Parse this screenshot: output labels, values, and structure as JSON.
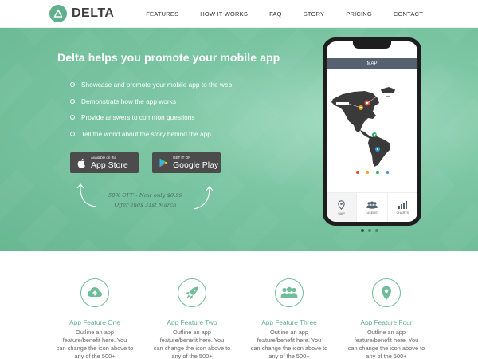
{
  "brand": {
    "name": "DELTA"
  },
  "nav": {
    "items": [
      {
        "label": "FEATURES"
      },
      {
        "label": "HOW IT WORKS"
      },
      {
        "label": "FAQ"
      },
      {
        "label": "STORY"
      },
      {
        "label": "PRICING"
      },
      {
        "label": "CONTACT"
      }
    ]
  },
  "hero": {
    "title": "Delta helps you promote your mobile app",
    "bullets": [
      "Showcase and promote your mobile app to the web",
      "Demonstrate how the app works",
      "Provide answers to common questions",
      "Tell the world about the story behind the app"
    ],
    "appstore": {
      "small": "Available on the",
      "big": "App Store"
    },
    "googleplay": {
      "small": "GET IT ON",
      "big": "Google Play"
    },
    "offer": {
      "line1": "50% OFF - Now only $0.99",
      "line2": "Offer ends 31st March"
    }
  },
  "phone": {
    "header": "MAP",
    "tabs": [
      {
        "label": "MAP",
        "icon": "map-pin-icon"
      },
      {
        "label": "USERS",
        "icon": "users-icon"
      },
      {
        "label": "CHARTS",
        "icon": "bar-chart-icon"
      }
    ],
    "dot_colors": [
      "#e74c3c",
      "#f39c12",
      "#27ae60",
      "#3498db"
    ],
    "marker_colors": [
      "#e74c3c",
      "#f39c12",
      "#27ae60",
      "#3498db"
    ]
  },
  "features": [
    {
      "title": "App Feature One",
      "desc": [
        "Outline an app",
        "feature/benefit here. You",
        "can change the icon above to",
        "any of the 500+"
      ],
      "icon": "cloud-upload-icon"
    },
    {
      "title": "App Feature Two",
      "desc": [
        "Outline an app",
        "feature/benefit here. You",
        "can change the icon above to",
        "any of the 500+"
      ],
      "icon": "rocket-icon"
    },
    {
      "title": "App Feature Three",
      "desc": [
        "Outline an app",
        "feature/benefit here. You",
        "can change the icon above to",
        "any of the 500+"
      ],
      "icon": "users-icon"
    },
    {
      "title": "App Feature Four",
      "desc": [
        "Outline an app",
        "feature/benefit here. You",
        "can change the icon above to",
        "any of the 500+"
      ],
      "icon": "map-pin-icon"
    }
  ],
  "colors": {
    "brand_green": "#5fb08b",
    "hero_green": "#7cc6a3",
    "button_dark": "#4c4c4c",
    "phone_header": "#576270"
  }
}
